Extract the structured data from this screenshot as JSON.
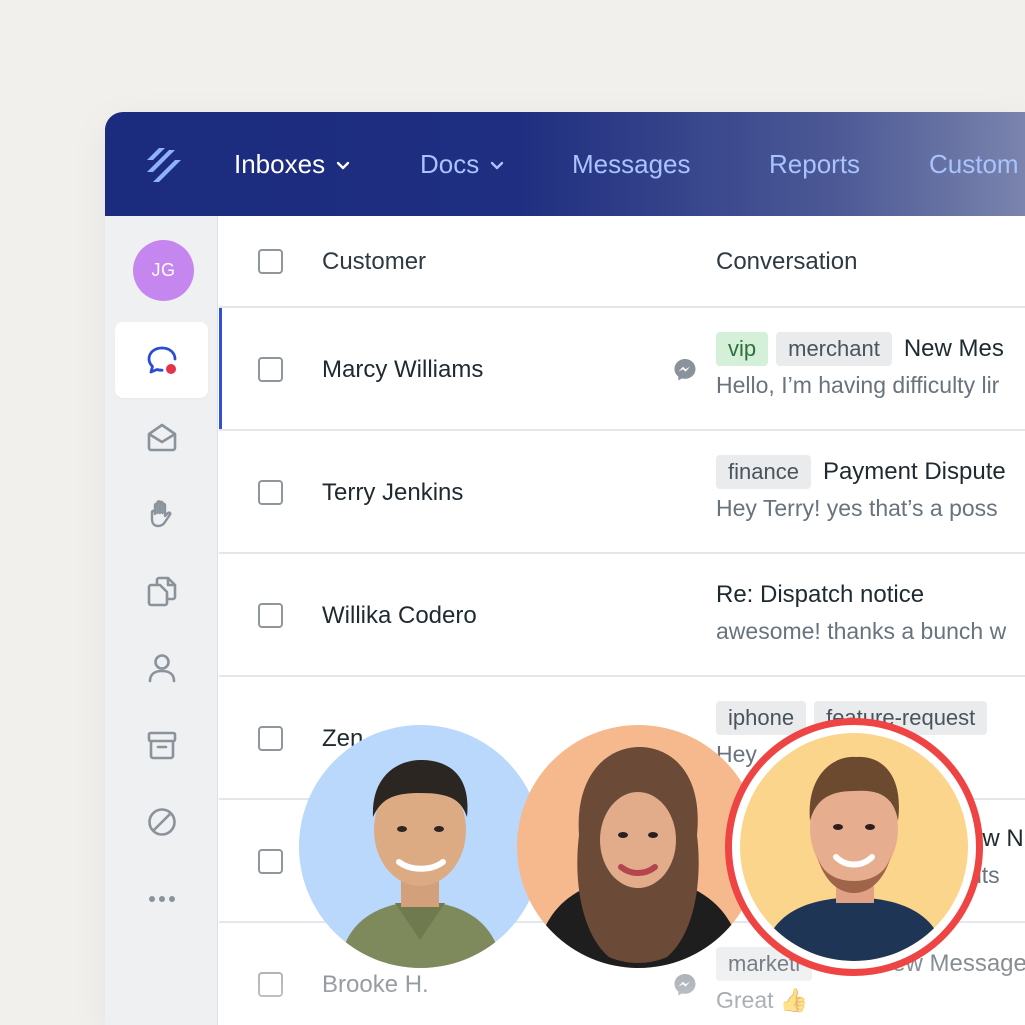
{
  "nav": {
    "items": [
      {
        "label": "Inboxes",
        "dropdown": true,
        "active": true
      },
      {
        "label": "Docs",
        "dropdown": true,
        "active": false
      },
      {
        "label": "Messages",
        "dropdown": false,
        "active": false
      },
      {
        "label": "Reports",
        "dropdown": false,
        "active": false
      },
      {
        "label": "Custom",
        "dropdown": false,
        "active": false
      }
    ]
  },
  "sidebar": {
    "user_initials": "JG",
    "icons": [
      "chat-notification-icon",
      "envelope-open-icon",
      "hand-icon",
      "documents-icon",
      "user-icon",
      "archive-icon",
      "blocked-icon",
      "more-icon"
    ]
  },
  "table": {
    "columns": {
      "customer": "Customer",
      "conversation": "Conversation"
    },
    "rows": [
      {
        "customer": "Marcy Williams",
        "tags": [
          "vip",
          "merchant"
        ],
        "subject": "New Mes",
        "preview": "Hello, I’m having difficulty lir",
        "messenger": true,
        "selected": true
      },
      {
        "customer": "Terry Jenkins",
        "tags": [
          "finance"
        ],
        "subject": "Payment Dispute",
        "preview": "Hey Terry! yes that’s a poss",
        "messenger": false,
        "selected": false
      },
      {
        "customer": "Willika Codero",
        "tags": [],
        "subject": "Re: Dispatch notice",
        "preview": "awesome! thanks a bunch w",
        "messenger": false,
        "selected": false
      },
      {
        "customer": "Zen",
        "tags": [
          "iphone",
          "feature-request"
        ],
        "subject": "",
        "preview": "Hey",
        "messenger": false,
        "selected": false
      },
      {
        "customer": "",
        "tags": [],
        "subject": "ew N",
        "preview": "nts",
        "messenger": false,
        "selected": false
      },
      {
        "customer": "Brooke H.",
        "tags": [
          "marketi"
        ],
        "subject": "ew Message",
        "preview": "Great 👍",
        "messenger": true,
        "selected": false
      }
    ]
  },
  "colors": {
    "nav_active": "#ffffff",
    "nav_inactive": "#a9c3ff",
    "selected_row_accent": "#3150d6",
    "ring_highlight": "#ef4444",
    "avatar_bg": "#c586f0"
  }
}
